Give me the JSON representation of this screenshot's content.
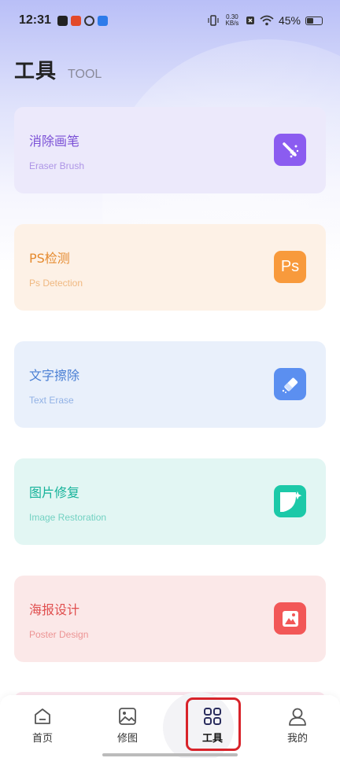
{
  "status_bar": {
    "time": "12:31",
    "net_speed_value": "0.30",
    "net_speed_unit": "KB/s",
    "battery_pct": "45%",
    "battery_level": 0.45
  },
  "header": {
    "title": "工具",
    "subtitle": "TOOL"
  },
  "tools": [
    {
      "title": "消除画笔",
      "subtitle": "Eraser Brush",
      "color": "#7a4fd6",
      "bg": "#ece9fb",
      "icon": "magic-brush-icon",
      "icon_bg": "#8b5cf0"
    },
    {
      "title": "PS检测",
      "subtitle": "Ps Detection",
      "color": "#e58a2e",
      "bg": "#fdf1e6",
      "icon": "ps-icon",
      "icon_label": "Ps",
      "icon_bg": "#f89a3c"
    },
    {
      "title": "文字擦除",
      "subtitle": "Text Erase",
      "color": "#4a7fd4",
      "bg": "#e9f0fb",
      "icon": "eraser-icon",
      "icon_bg": "#5b8ff0"
    },
    {
      "title": "图片修复",
      "subtitle": "Image Restoration",
      "color": "#16b39a",
      "bg": "#e2f6f3",
      "icon": "image-restore-icon",
      "icon_bg": "#1cc9a8"
    },
    {
      "title": "海报设计",
      "subtitle": "Poster Design",
      "color": "#e04e4e",
      "bg": "#fbe8e8",
      "icon": "poster-icon",
      "icon_bg": "#f25757"
    }
  ],
  "tabbar": {
    "home": "首页",
    "retouch": "修图",
    "tools": "工具",
    "mine": "我的",
    "active": "tools"
  }
}
